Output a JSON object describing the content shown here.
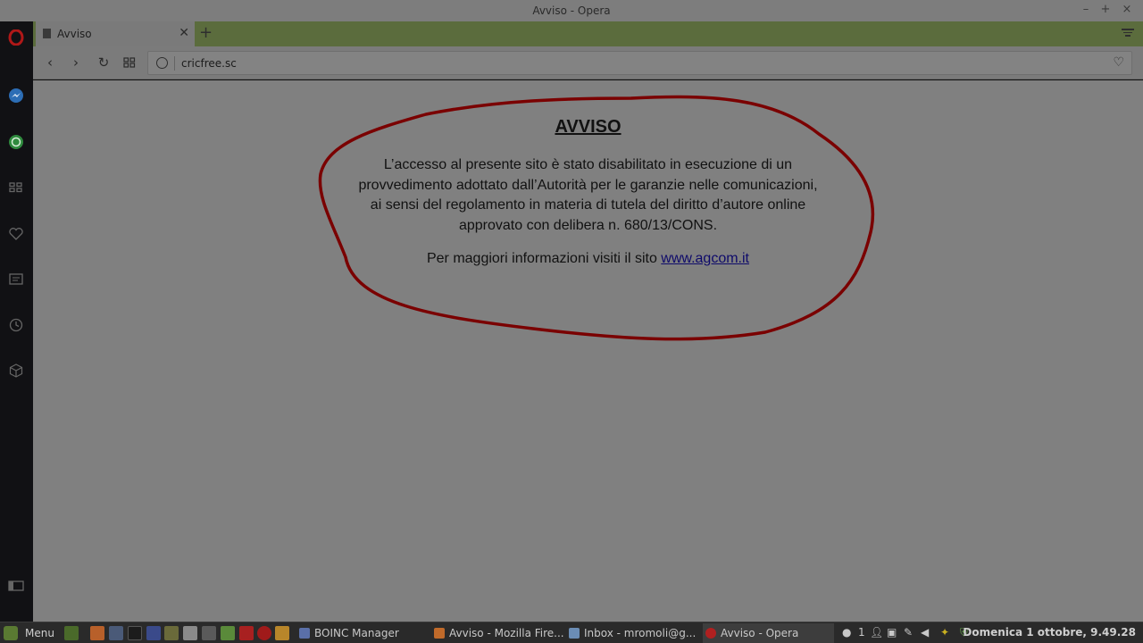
{
  "window": {
    "title": "Avviso - Opera",
    "controls": [
      "–",
      "+",
      "×"
    ]
  },
  "tabs": [
    {
      "label": "Avviso",
      "active": true
    }
  ],
  "toolbar": {
    "url": "cricfree.sc"
  },
  "page": {
    "title": "AVVISO",
    "body_lines": [
      "L’accesso al presente sito è stato disabilitato in esecuzione di un",
      "provvedimento adottato dall’Autorità per le garanzie nelle comunicazioni,",
      "ai sensi del regolamento in materia di tutela del diritto d’autore online",
      "approvato con delibera n. 680/13/CONS."
    ],
    "info_text": "Per maggiori informazioni visiti il sito",
    "info_link": "www.agcom.it"
  },
  "sidebar": {
    "items": [
      "opera-logo-icon",
      "messenger-icon",
      "whatsapp-icon",
      "speed-dial-icon",
      "bookmarks-icon",
      "news-icon",
      "history-icon",
      "extensions-icon",
      "sidebar-toggle-icon"
    ]
  },
  "taskbar": {
    "menu_label": "Menu",
    "tasks": [
      {
        "label": "BOINC Manager",
        "color": "#5a6fa8"
      },
      {
        "label": "Avviso - Mozilla Fire...",
        "color": "#c06a2a"
      },
      {
        "label": "Inbox - mromoli@g...",
        "color": "#6b8db5"
      },
      {
        "label": "Avviso - Opera",
        "color": "#b02020",
        "active": true
      }
    ],
    "tray_count": "1",
    "clock": "Domenica  1 ottobre,  9.49.28"
  },
  "colors": {
    "accent_tab": "#5b6c3d",
    "scribble": "#7a0000",
    "opera_red": "#c01818"
  }
}
